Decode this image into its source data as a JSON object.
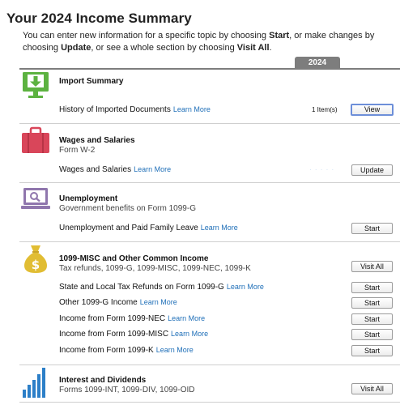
{
  "page": {
    "title": "Your 2024 Income Summary",
    "intro": {
      "p1": "You can enter new information for a specific topic by choosing ",
      "start": "Start",
      "p2": ", or make changes by choosing ",
      "update": "Update",
      "p3": ", or see a whole section by choosing ",
      "visit_all": "Visit All",
      "p4": "."
    },
    "year_tab": "2024"
  },
  "colors": {
    "import": "#5cb240",
    "wages": "#d9465a",
    "unemployment": "#8f76ad",
    "misc": "#e1bd33",
    "interest": "#2c7fc8",
    "learn_more": "#1f6fb8"
  },
  "learn_more": "Learn More",
  "sections": {
    "import_summary": {
      "icon": "download-monitor-icon",
      "title": "Import Summary",
      "row_label": "History of Imported Documents",
      "count": "1 Item(s)",
      "button": "View"
    },
    "wages": {
      "icon": "briefcase-icon",
      "title": "Wages and Salaries",
      "subtitle": "Form W-2",
      "row_label": "Wages and Salaries",
      "faded_value": "· · · · ·",
      "button": "Update"
    },
    "unemployment": {
      "icon": "laptop-search-icon",
      "title": "Unemployment",
      "subtitle": "Government benefits on Form 1099-G",
      "row_label": "Unemployment and Paid Family Leave",
      "button": "Start"
    },
    "misc": {
      "icon": "money-bag-icon",
      "title": "1099-MISC and Other Common Income",
      "subtitle": "Tax refunds, 1099-G, 1099-MISC, 1099-NEC, 1099-K",
      "button": "Visit All",
      "rows": [
        {
          "label": "State and Local Tax Refunds on Form 1099-G",
          "button": "Start"
        },
        {
          "label": "Other 1099-G Income",
          "button": "Start"
        },
        {
          "label": "Income from Form 1099-NEC",
          "button": "Start"
        },
        {
          "label": "Income from Form 1099-MISC",
          "button": "Start"
        },
        {
          "label": "Income from Form 1099-K",
          "button": "Start"
        }
      ]
    },
    "interest": {
      "icon": "bar-chart-icon",
      "title": "Interest and Dividends",
      "subtitle": "Forms 1099-INT, 1099-DIV, 1099-OID",
      "button": "Visit All"
    }
  }
}
